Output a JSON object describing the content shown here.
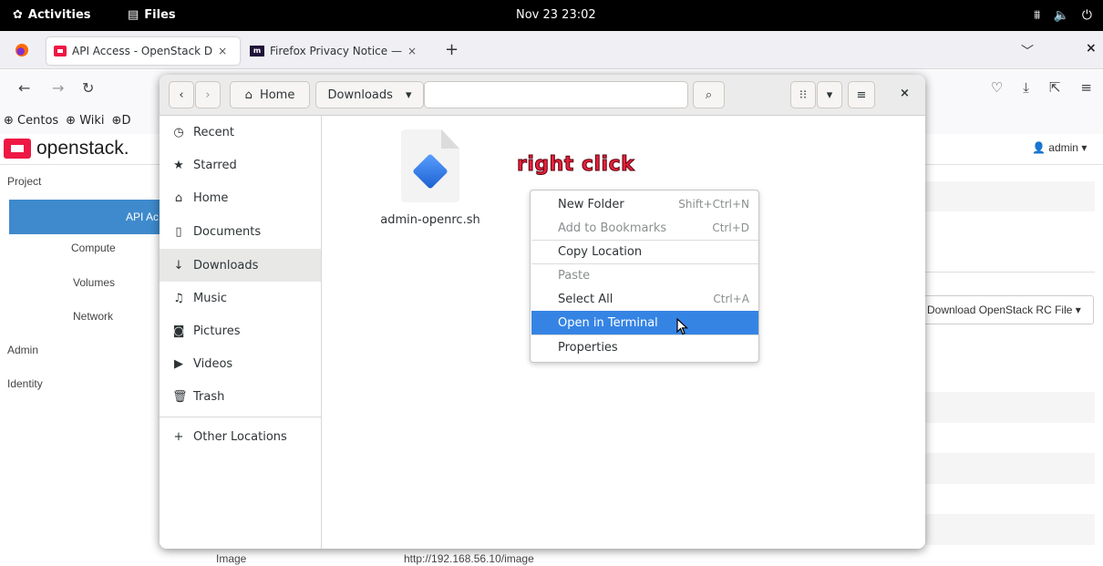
{
  "topbar": {
    "activities": "Activities",
    "app": "Files",
    "clock": "Nov 23  23:02"
  },
  "firefox": {
    "tabs": [
      {
        "title": "API Access - OpenStack D",
        "close": "×"
      },
      {
        "title": "Firefox Privacy Notice — ",
        "close": "×"
      }
    ],
    "new_tab": "+",
    "tab_list": "﹀",
    "window_close": "×",
    "bookmarks": [
      "Centos",
      "Wiki",
      "D"
    ]
  },
  "openstack": {
    "logo": "openstack.",
    "user": "admin ▾",
    "sidebar": {
      "project": "Project",
      "api_access": "API Ac",
      "compute": "Compute",
      "volumes": "Volumes",
      "network": "Network",
      "admin": "Admin",
      "identity": "Identity"
    },
    "download_rc": "Download OpenStack RC File ▾",
    "footer_service": "Image",
    "footer_url": "http://192.168.56.10/image"
  },
  "files": {
    "path_home": "Home",
    "path_current": "Downloads",
    "sidebar": [
      {
        "icon": "clock-icon",
        "glyph": "◷",
        "label": "Recent"
      },
      {
        "icon": "star-icon",
        "glyph": "★",
        "label": "Starred"
      },
      {
        "icon": "home-icon",
        "glyph": "⌂",
        "label": "Home"
      },
      {
        "icon": "document-icon",
        "glyph": "▯",
        "label": "Documents"
      },
      {
        "icon": "download-icon",
        "glyph": "↓",
        "label": "Downloads"
      },
      {
        "icon": "music-icon",
        "glyph": "♫",
        "label": "Music"
      },
      {
        "icon": "camera-icon",
        "glyph": "◙",
        "label": "Pictures"
      },
      {
        "icon": "video-icon",
        "glyph": "▶",
        "label": "Videos"
      },
      {
        "icon": "trash-icon",
        "glyph": "🗑",
        "label": "Trash"
      }
    ],
    "other_locations": "Other Locations",
    "file": {
      "name": "admin-openrc.sh",
      "icon": "shell-script-icon"
    }
  },
  "annotation": "right click",
  "context_menu": [
    {
      "label": "New Folder",
      "accel": "Shift+Ctrl+N",
      "state": "normal"
    },
    {
      "label": "Add to Bookmarks",
      "accel": "Ctrl+D",
      "state": "disabled"
    },
    {
      "label": "Copy Location",
      "accel": "",
      "state": "normal"
    },
    {
      "label": "Paste",
      "accel": "",
      "state": "disabled"
    },
    {
      "label": "Select All",
      "accel": "Ctrl+A",
      "state": "normal"
    },
    {
      "label": "Open in Terminal",
      "accel": "",
      "state": "highlighted"
    },
    {
      "label": "Properties",
      "accel": "",
      "state": "normal"
    }
  ],
  "colors": {
    "highlight": "#3584e4",
    "annotation": "#e8203a",
    "openstack_red": "#ed1944",
    "openstack_active": "#3e8acc"
  }
}
